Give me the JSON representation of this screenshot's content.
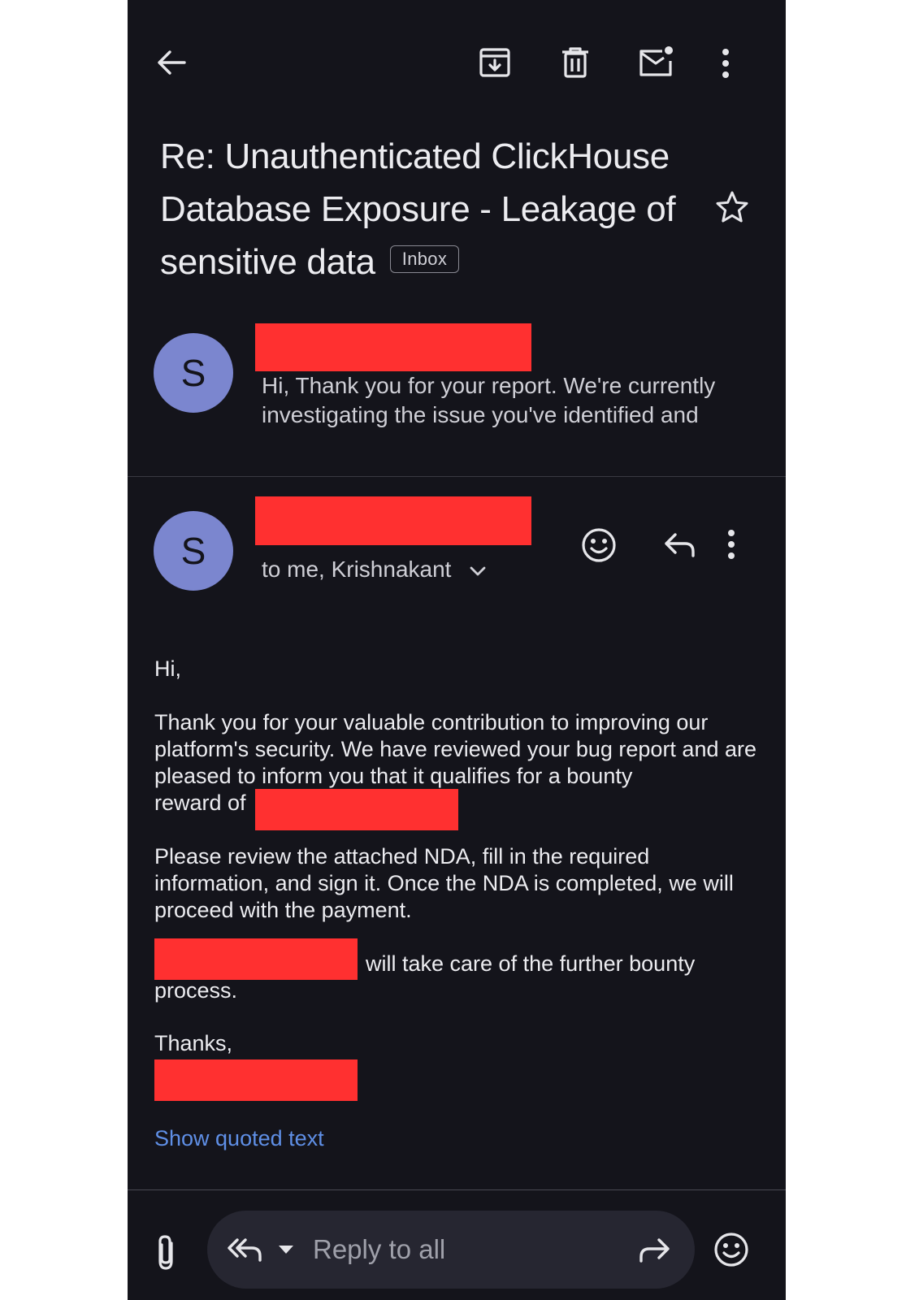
{
  "toolbar": {
    "back_icon": "arrow-left-icon",
    "archive_icon": "archive-icon",
    "delete_icon": "trash-icon",
    "mark_unread_icon": "mail-unread-icon",
    "more_icon": "more-vert-icon"
  },
  "subject": {
    "text": "Re: Unauthenticated ClickHouse Database Exposure - Leakage of sensitive data",
    "label_chip": "Inbox"
  },
  "thread": {
    "collapsed_message": {
      "avatar_letter": "S",
      "snippet": "Hi, Thank you for your report. We're currently investigating the issue you've identified and"
    },
    "expanded_message": {
      "avatar_letter": "S",
      "recipients": "to me, Krishnakant",
      "body": {
        "greeting": "Hi,",
        "paragraph1": "Thank you for your valuable contribution to improving our platform's security. We have reviewed your bug report and are pleased to inform you that it qualifies for a bounty",
        "paragraph1_end": "reward of",
        "paragraph2": "Please review the attached NDA, fill in the required information, and sign it. Once the NDA is completed, we will proceed with the payment.",
        "paragraph3_after_redaction": "will take care of the further bounty",
        "paragraph3_end": "process.",
        "signoff": "Thanks,"
      },
      "show_quoted": "Show quoted text"
    }
  },
  "bottom_bar": {
    "reply_placeholder": "Reply to all"
  },
  "colors": {
    "background": "#14141b",
    "avatar": "#7b86cf",
    "redaction": "#ff3030",
    "link": "#5f8fe6"
  }
}
